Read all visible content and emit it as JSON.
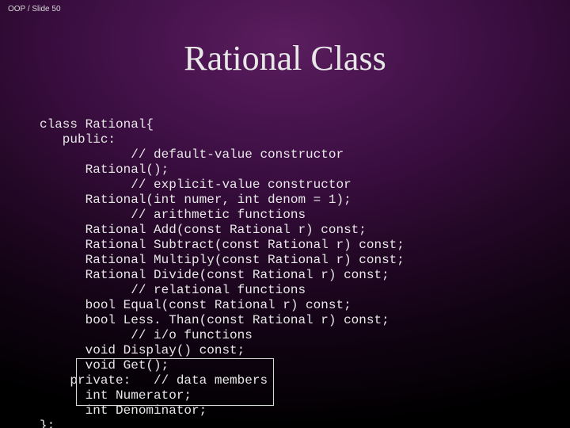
{
  "header": "OOP / Slide 50",
  "title": "Rational Class",
  "code": {
    "l1": "class Rational{",
    "l2": "   public:",
    "l3": "            // default-value constructor",
    "l4": "      Rational();",
    "l5": "            // explicit-value constructor",
    "l6": "      Rational(int numer, int denom = 1);",
    "l7": "            // arithmetic functions",
    "l8": "      Rational Add(const Rational r) const;",
    "l9": "      Rational Subtract(const Rational r) const;",
    "l10": "      Rational Multiply(const Rational r) const;",
    "l11": "      Rational Divide(const Rational r) const;",
    "l12": "            // relational functions",
    "l13": "      bool Equal(const Rational r) const;",
    "l14": "      bool Less. Than(const Rational r) const;",
    "l15": "            // i/o functions",
    "l16": "      void Display() const;",
    "l17": "      void Get();",
    "l18": "    private:   // data members",
    "l19": "      int Numerator;",
    "l20": "      int Denominator;",
    "l21": "};"
  }
}
